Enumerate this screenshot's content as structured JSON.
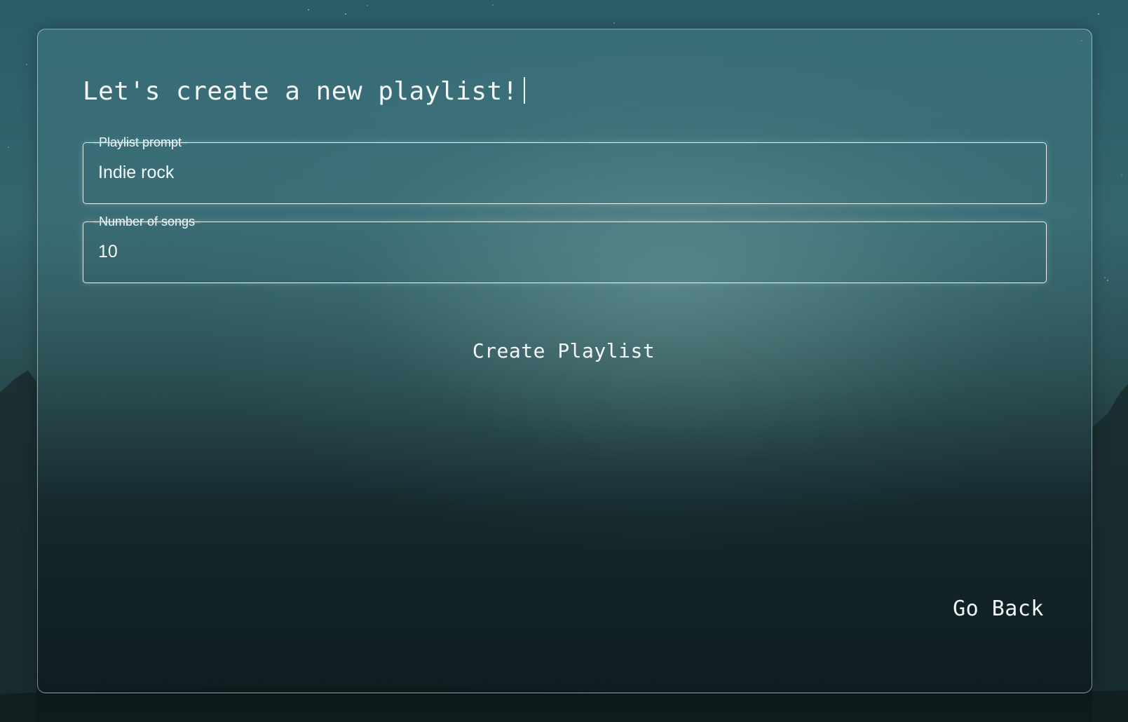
{
  "page": {
    "heading": "Let's create a new playlist!"
  },
  "form": {
    "prompt": {
      "label": "Playlist prompt",
      "value": "Indie rock"
    },
    "songs": {
      "label": "Number of songs",
      "value": "10"
    }
  },
  "actions": {
    "create_label": "Create Playlist",
    "back_label": "Go Back"
  },
  "colors": {
    "text": "#f4f8f8",
    "border": "#eef4f4",
    "background_top": "#2a5c68",
    "background_bottom": "#0f1e21"
  }
}
